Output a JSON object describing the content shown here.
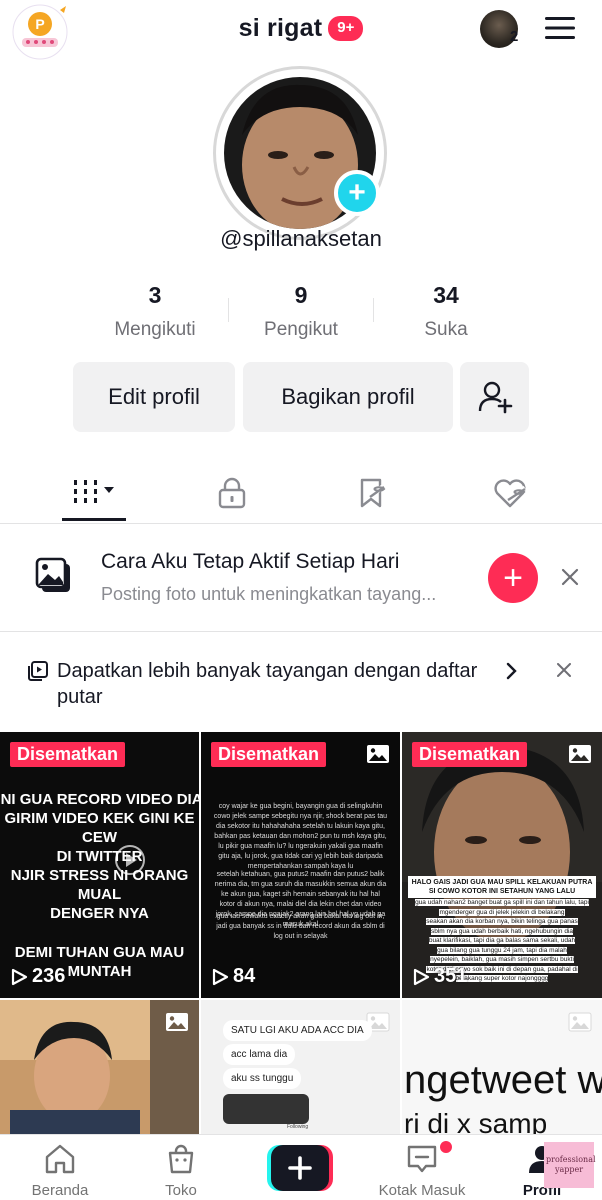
{
  "header": {
    "title": "si rigat",
    "notification_badge": "9+",
    "account_count": "2",
    "logo_icon": "p-logo-sticker",
    "menu_icon": "hamburger-menu-icon"
  },
  "profile": {
    "username": "@spillanaksetan",
    "stats": [
      {
        "value": "3",
        "label": "Mengikuti"
      },
      {
        "value": "9",
        "label": "Pengikut"
      },
      {
        "value": "34",
        "label": "Suka"
      }
    ],
    "edit_label": "Edit profil",
    "share_label": "Bagikan profil"
  },
  "tabs": [
    "videos-grid-icon",
    "lock-icon",
    "saved-icon",
    "liked-icon"
  ],
  "suggestion": {
    "title": "Cara Aku Tetap Aktif Setiap Hari",
    "subtitle": "Posting foto untuk meningkatkan tayang..."
  },
  "playlist_banner": {
    "text": "Dapatkan lebih banyak tayangan dengan daftar putar"
  },
  "grid": {
    "pinned_label": "Disematkan",
    "tiles": [
      {
        "views": "236",
        "lines": [
          "INI GUA RECORD VIDEO DIA",
          "GIRIM VIDEO KEK GINI KE CEW",
          "DI TWITTER",
          "NJIR STRESS NI ORANG MUAL",
          "DENGER NYA",
          "DEMI TUHAN GUA MAU MUNTAH"
        ]
      },
      {
        "views": "84",
        "paragraphs": [
          "coy wajar ke gua begini, bayangin gua di selingkuhin cowo jelek sampe sebegitu nya njir, shock berat pas tau dia sekotor itu hahahahaha setelah tu lakuin kaya gitu, bahkan pas ketauan dan mohon2 pun tu msh kaya gitu, lu pikir gua maafin lu? lu ngerakuin yakali gua maafin gitu aja, lu jorok, gua tidak cari yg lebih baik daripada mempertahankan sampah kaya lu",
          "setelah ketahuan, gua putus2 maafin dan putus2 balik nerima dia, tm gua suruh dia masukkin semua akun dia ke akun gua, kaget sih hemain sebanyak itu hal hal kotor di akun nya, malai diel dia lekin chet dan video jorok, sampe dia ngajak2 orang lain hal hal yg udah ga masuk akal",
          "gua tau sewaktu exactly akun gua bakal dia log out in, jadi gua banyak ss in dulu dan record akun dia sblm di log out in selayak"
        ]
      },
      {
        "views": "351",
        "caption_title": "HALO GAIS JADI GUA MAU SPILL KELAKUAN PUTRA SI COWO KOTOR INI SETAHUN YANG LALU",
        "caption_lines": [
          "gua udah nahan2 banget buat ga spill ini dan tahun lalu, tapi mgenderger gua di jelek jelekin di belakang",
          "seakan akan dia korban nya, bikin telinga gua panas",
          "sblm nya gua udah berbaik hati, ngehubungin dia",
          "buat klarifikasi, tapi dia ga balas sama sekali, udah",
          "gua bilang gua tunggu 24 jam, tapi dia malah",
          "nyepelein, baiklah, gua masih simpen sertbu bukti",
          "kotor dari cowo sok baik ini di depan gua, padahal di",
          "belakang super kotor najongggg"
        ]
      },
      {
        "views": ""
      },
      {
        "views": "",
        "lines": [
          "SATU LGI AKU ADA ACC DIA",
          "acc lama dia",
          "aku ss tunggu"
        ],
        "footer": "Following"
      },
      {
        "views": "",
        "lines": [
          "ngetweet w",
          "ri di x samp"
        ]
      }
    ]
  },
  "bottom_nav": {
    "items": [
      {
        "label": "Beranda",
        "icon": "home-icon"
      },
      {
        "label": "Toko",
        "icon": "shop-bag-icon"
      },
      {
        "label": "",
        "icon": "create-plus-icon"
      },
      {
        "label": "Kotak Masuk",
        "icon": "inbox-icon"
      },
      {
        "label": "Profil",
        "icon": "profile-icon"
      }
    ]
  },
  "watermark": "professional yapper",
  "colors": {
    "accent": "#fe2c55",
    "cyan": "#20d5ec",
    "text": "#161823",
    "muted": "#8a8b91",
    "button_bg": "#f1f1f2"
  }
}
